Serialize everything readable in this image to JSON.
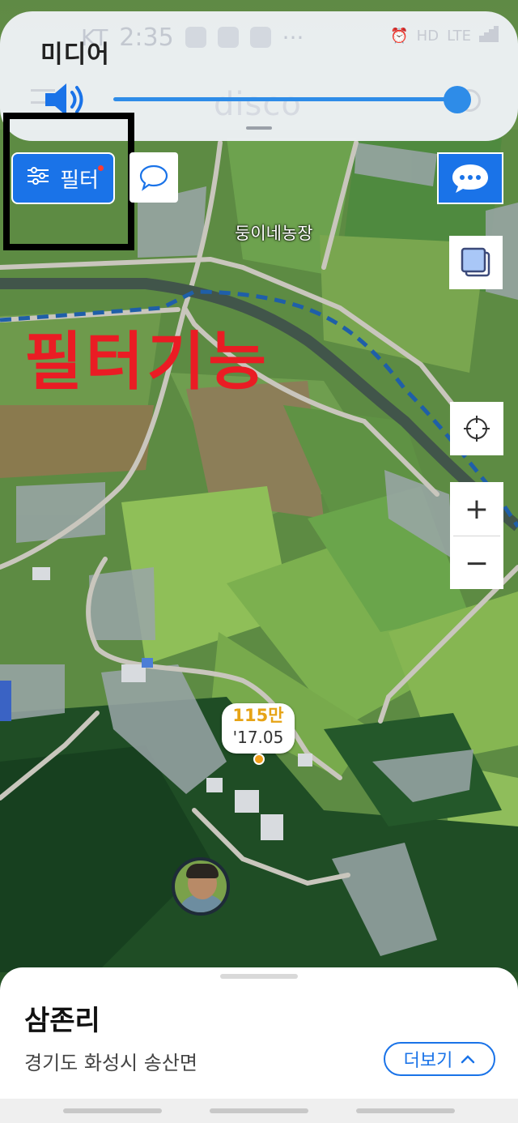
{
  "status_bar": {
    "carrier": "KT",
    "time": "2:35",
    "network": "LTE",
    "hd": "HD"
  },
  "volume_panel": {
    "label": "미디어",
    "icon": "speaker-icon",
    "level": 0.96
  },
  "app": {
    "title": "disco"
  },
  "map": {
    "farm_label": "둥이네농장",
    "annotation_text": "필터기능",
    "listing": {
      "price": "115만",
      "date": "'17.05"
    }
  },
  "controls": {
    "filter_label": "필터",
    "zoom_in": "+",
    "zoom_out": "−"
  },
  "bottom_sheet": {
    "place_name": "삼존리",
    "address": "경기도 화성시 송산면",
    "more_label": "더보기"
  },
  "colors": {
    "accent": "#1a73e8",
    "annotation": "#ea1c24",
    "price": "#e6a315"
  }
}
